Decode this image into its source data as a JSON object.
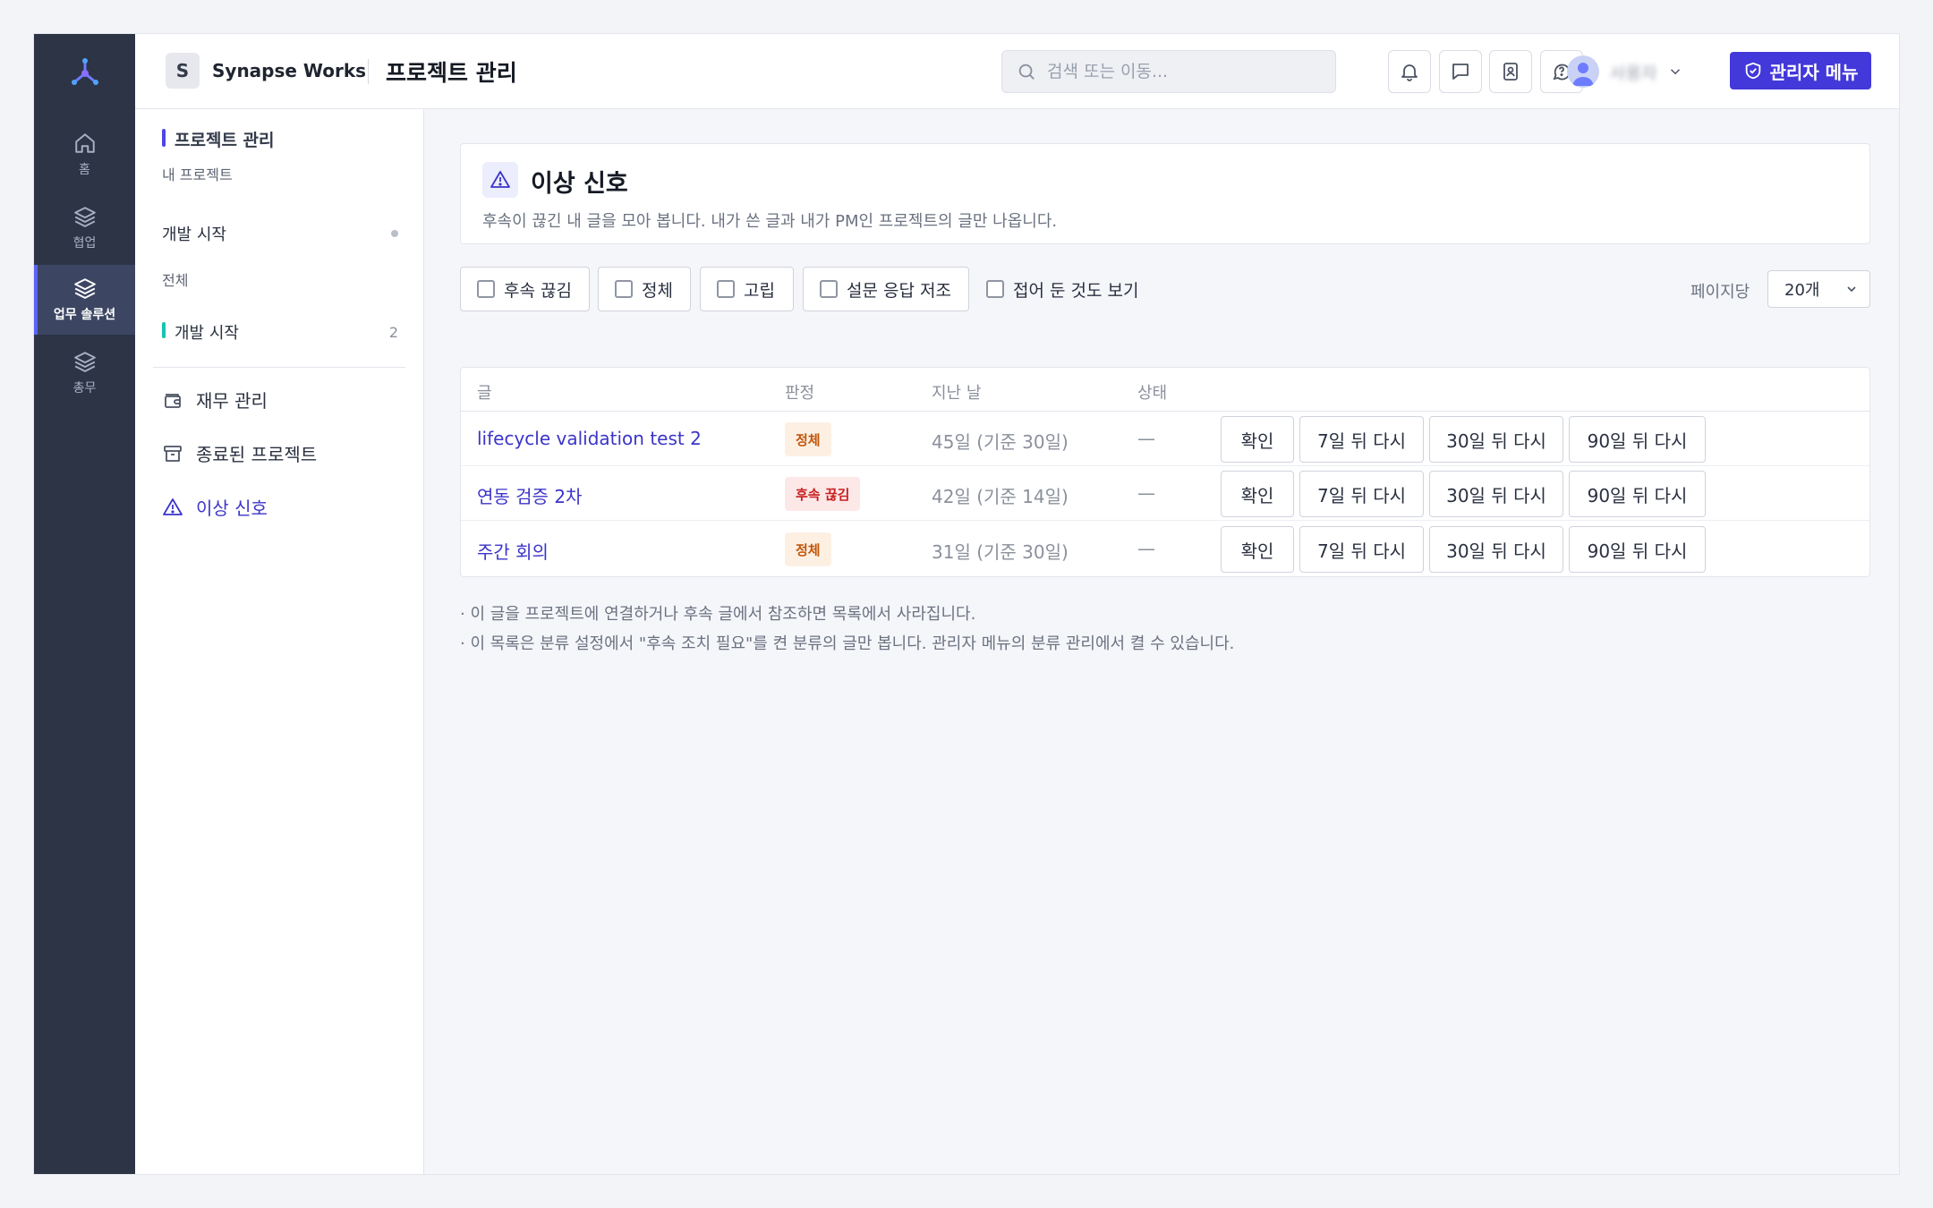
{
  "colors": {
    "rail_bg": "#2c3446",
    "accent": "#4338d9",
    "link": "#3b34c9",
    "teal": "#15c5b0"
  },
  "rail": {
    "items": [
      {
        "label": "홈",
        "icon": "home-icon"
      },
      {
        "label": "협업",
        "icon": "layers-icon"
      },
      {
        "label": "업무 솔루션",
        "icon": "layers-icon",
        "active": true
      },
      {
        "label": "총무",
        "icon": "layers-icon"
      }
    ]
  },
  "header": {
    "workspace_initial": "S",
    "workspace_name": "Synapse Works",
    "page_title": "프로젝트 관리",
    "search_placeholder": "검색 또는 이동...",
    "admin_label": "관리자 메뉴",
    "user_name": "사용자"
  },
  "sidebar": {
    "section_title": "프로젝트 관리",
    "my_projects": "내 프로젝트",
    "dev_start": "개발 시작",
    "all": "전체",
    "group_dev_start": "개발 시작",
    "group_dev_start_count": "2",
    "links": [
      {
        "label": "재무 관리",
        "icon": "wallet-icon"
      },
      {
        "label": "종료된 프로젝트",
        "icon": "archive-icon"
      },
      {
        "label": "이상 신호",
        "icon": "alert-triangle-icon",
        "active": true
      }
    ]
  },
  "main": {
    "title": "이상 신호",
    "description": "후속이 끊긴 내 글을 모아 봅니다. 내가 쓴 글과 내가 PM인 프로젝트의 글만 나옵니다.",
    "filters": [
      "후속 끊김",
      "정체",
      "고립",
      "설문 응답 저조"
    ],
    "show_collapsed": "접어 둔 것도 보기",
    "per_page_label": "페이지당",
    "per_page_value": "20개",
    "columns": [
      "글",
      "판정",
      "지난 날",
      "상태"
    ],
    "rows": [
      {
        "title": "lifecycle validation test 2",
        "verdict": "정체",
        "verdict_type": "stale",
        "elapsed": "45일 (기준 30일)",
        "status": "—"
      },
      {
        "title": "연동 검증 2차",
        "verdict": "후속 끊김",
        "verdict_type": "broken",
        "elapsed": "42일 (기준 14일)",
        "status": "—"
      },
      {
        "title": "주간 회의",
        "verdict": "정체",
        "verdict_type": "stale",
        "elapsed": "31일 (기준 30일)",
        "status": "—"
      }
    ],
    "actions": [
      "확인",
      "7일 뒤 다시",
      "30일 뒤 다시",
      "90일 뒤 다시"
    ],
    "notes": [
      "· 이 글을 프로젝트에 연결하거나 후속 글에서 참조하면 목록에서 사라집니다.",
      "· 이 목록은 분류 설정에서 \"후속 조치 필요\"를 켠 분류의 글만 봅니다. 관리자 메뉴의 분류 관리에서 켤 수 있습니다."
    ]
  }
}
